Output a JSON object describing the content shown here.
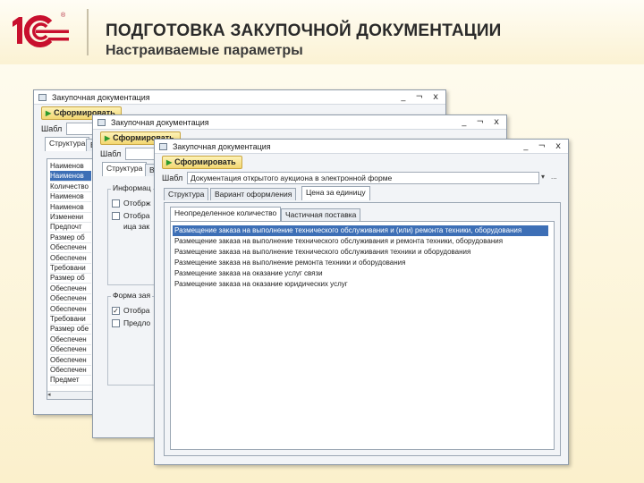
{
  "slide": {
    "title": "ПОДГОТОВКА ЗАКУПОЧНОЙ ДОКУМЕНТАЦИИ",
    "subtitle": "Настраиваемые параметры",
    "logo_text": "1С",
    "logo_mark": "®"
  },
  "colors": {
    "logo_red": "#c8102e",
    "selection": "#3d6fb6",
    "form_button": "#f3d771"
  },
  "window_controls": "_ ¬ x",
  "window1": {
    "title": "Закупочная документация",
    "form_button": "Сформировать",
    "template_label": "Шабл",
    "tabs": [
      "Структура",
      "В"
    ],
    "list_items": [
      "Наименов",
      "Наименов",
      "Количество",
      "Наименов",
      "Наименов",
      "Изменени",
      "Предпочт",
      "Размер об",
      "Обеспечен",
      "Обеспечен",
      "Требовани",
      "Размер об",
      "Обеспечен",
      "Обеспечен",
      "Обеспечен",
      "Требовани",
      "Размер обе",
      "Обеспечен",
      "Обеспечен",
      "Обеспечен",
      "Обеспечен",
      "Предмет"
    ],
    "selected_index": 1
  },
  "window2": {
    "title": "Закупочная документация",
    "form_button": "Сформировать",
    "template_label": "Шабл",
    "tabs": [
      "Структура",
      "В"
    ],
    "group1_title": "Информац",
    "group1_items": [
      {
        "label": "Отобрж",
        "checked": false
      },
      {
        "label": "Отобра",
        "checked": false
      },
      {
        "label": "ица зак",
        "checked": false
      }
    ],
    "group2_title": "Форма зая",
    "group2_items": [
      {
        "label": "Отобра",
        "checked": true
      },
      {
        "label": "Предло",
        "checked": false
      }
    ]
  },
  "window3": {
    "title": "Закупочная документация",
    "form_button": "Сформировать",
    "template_label": "Шабл",
    "template_value": "Документация открытого аукциона в электронной форме",
    "tabs": [
      "Структура",
      "Вариант оформления",
      "Цена за единицу"
    ],
    "active_tab": 2,
    "inner_tabs": [
      "Неопределенное количество",
      "Частичная поставка"
    ],
    "active_inner_tab": 0,
    "items": [
      "Размещение заказа на выполнение технического обслуживания и (или) ремонта техники, оборудования",
      "Размещение заказа на выполнение технического обслуживания и ремонта техники, оборудования",
      "Размещение заказа на выполнение технического обслуживания техники и оборудования",
      "Размещение заказа на выполнение ремонта техники и оборудования",
      "Размещение заказа на оказание услуг связи",
      "Размещение заказа на оказание юридических услуг"
    ],
    "selected_index": 0
  }
}
